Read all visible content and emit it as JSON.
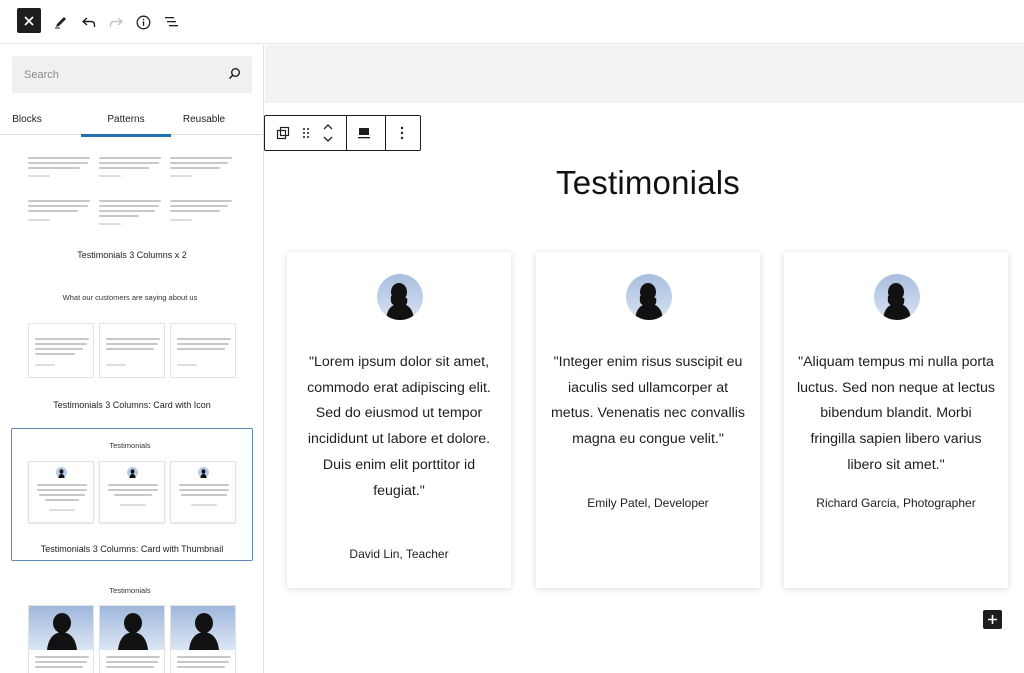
{
  "toolbar": {
    "close_icon": "close-icon",
    "edit_icon": "pencil-icon",
    "undo_icon": "undo-icon",
    "redo_icon": "redo-icon",
    "info_icon": "info-icon",
    "list_view_icon": "list-view-icon"
  },
  "sidebar": {
    "search_placeholder": "Search",
    "tabs": [
      {
        "label": "Blocks"
      },
      {
        "label": "Patterns"
      },
      {
        "label": "Reusable"
      }
    ],
    "active_tab": "Patterns",
    "patterns": [
      {
        "label": "Testimonials 3 Columns x 2"
      },
      {
        "label": "Testimonials 3 Columns: Card with Icon",
        "preview_heading": "What our customers are saying about us"
      },
      {
        "label": "Testimonials 3 Columns: Card with Thumbnail",
        "preview_heading": "Testimonials"
      },
      {
        "label": "",
        "preview_heading": "Testimonials"
      }
    ]
  },
  "canvas": {
    "title": "Testimonials",
    "cards": [
      {
        "quote": "\"Lorem ipsum dolor sit amet, commodo erat adipiscing elit. Sed do eiusmod ut tempor incididunt ut labore et dolore. Duis enim elit porttitor id feugiat.\"",
        "author": "David Lin, Teacher"
      },
      {
        "quote": "\"Integer enim risus suscipit eu iaculis sed ullamcorper at metus. Venenatis nec convallis magna eu congue velit.\"",
        "author": "Emily Patel, Developer"
      },
      {
        "quote": "\"Aliquam tempus mi nulla porta luctus. Sed non neque at lectus bibendum blandit. Morbi fringilla sapien libero varius libero sit amet.\"",
        "author": "Richard Garcia, Photographer"
      }
    ]
  },
  "colors": {
    "accent": "#2271b1",
    "selection_outline": "#5b87b7",
    "dark": "#1e1e1e"
  }
}
